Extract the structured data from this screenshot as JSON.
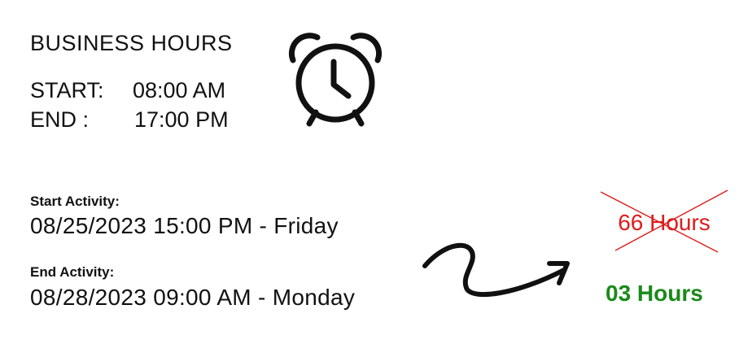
{
  "business_hours": {
    "title": "BUSINESS HOURS",
    "start_label": "START:",
    "start_value": "08:00 AM",
    "end_label": "END :",
    "end_value": "17:00 PM"
  },
  "icons": {
    "clock": "alarm-clock-icon",
    "arrow": "curved-arrow-icon"
  },
  "activity": {
    "start_label": "Start Activity:",
    "start_value": "08/25/2023  15:00 PM - Friday",
    "end_label": "End Activity:",
    "end_value": "08/28/2023  09:00 AM - Monday"
  },
  "result": {
    "crossed_out": "66 Hours",
    "correct": "03 Hours",
    "crossed_color": "#e01b1b",
    "correct_color": "#1a8a1a"
  }
}
